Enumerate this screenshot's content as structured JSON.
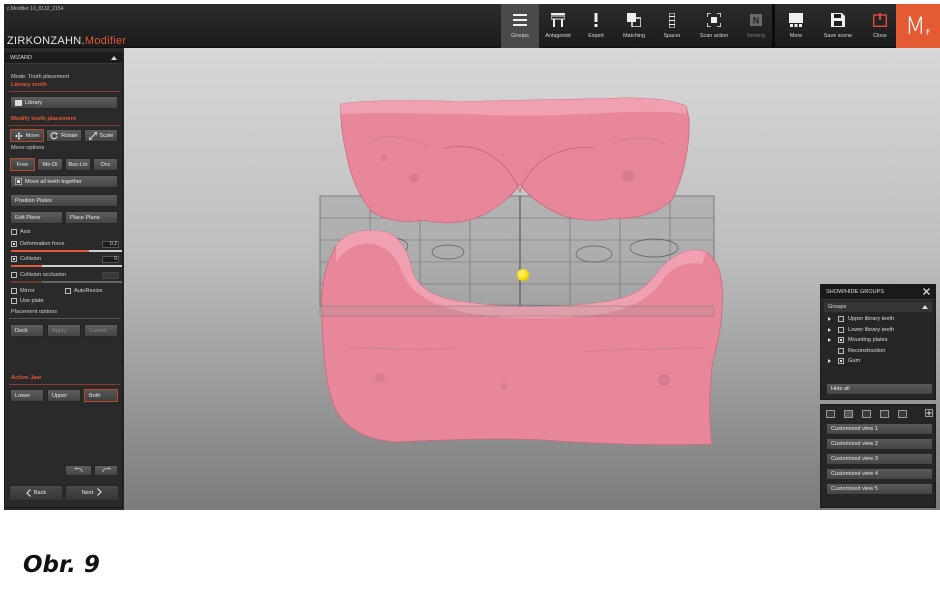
{
  "window": {
    "title": "c.Modifier 10_8132_2154"
  },
  "brand": {
    "name": "ZIRKONZAHN.",
    "product": "Modifier"
  },
  "toolbar": [
    {
      "label": "Groups",
      "icon": "hamburger-icon"
    },
    {
      "label": "Antagonist",
      "icon": "antagonist-icon"
    },
    {
      "label": "Expert",
      "icon": "exclamation-icon"
    },
    {
      "label": "Matching",
      "icon": "matching-icon"
    },
    {
      "label": "Spacer",
      "icon": "spacer-icon"
    },
    {
      "label": "Scan action",
      "icon": "scan-action-icon"
    },
    {
      "label": "Nesting",
      "icon": "nesting-icon"
    }
  ],
  "toolbar_right": [
    {
      "label": "More",
      "icon": "more-icon"
    },
    {
      "label": "Save scene",
      "icon": "save-icon"
    },
    {
      "label": "Close",
      "icon": "power-icon"
    }
  ],
  "logo": {
    "letter": "M",
    "sub": "F",
    "color": "#e35a33"
  },
  "wizard": {
    "title": "WIZARD",
    "mode": "Mode: Tooth placement",
    "library_section": "Library tooth",
    "library_button": "Library",
    "modify_section": "Modify tooth placement",
    "move": "Move",
    "rotate": "Rotate",
    "scale": "Scale",
    "move_options": "Move options",
    "free": "Free",
    "me_di": "Me-Di",
    "buc_lin": "Buc-Lin",
    "occ": "Occ",
    "move_all": "Move all teeth together",
    "position_plates": "Position Plates",
    "edit_plane": "Edit Plane",
    "place_plane": "Place Plane",
    "axis": "Axis",
    "deformation_force": "Deformation force",
    "deformation_value": "0.2",
    "collision": "Collision",
    "collision_value": "0",
    "collision_occlusion": "Collision occlusion",
    "mirror": "Mirror",
    "auto_resize": "AutoResize",
    "use_plate": "Use plate",
    "placement_options": "Placement options",
    "dock": "Dock",
    "apply": "Apply",
    "cancel": "Cancel",
    "active_jaw": "Active Jaw",
    "lower": "Lower",
    "upper": "Upper",
    "both": "Both",
    "back": "Back",
    "next": "Next"
  },
  "groups_panel": {
    "title": "SHOW/HIDE GROUPS",
    "sub": "Groups",
    "items": [
      {
        "label": "Upper library teeth",
        "checked": false,
        "arrow": true,
        "box": true
      },
      {
        "label": "Lower library teeth",
        "checked": false,
        "arrow": true,
        "box": true
      },
      {
        "label": "Mounting plates",
        "checked": true,
        "arrow": true,
        "box": true
      },
      {
        "label": "Reconstruction",
        "checked": false,
        "arrow": false,
        "box": true
      },
      {
        "label": "Gum",
        "checked": true,
        "arrow": true,
        "box": true
      }
    ],
    "hide_all": "Hide all"
  },
  "views": [
    "Customized view 1",
    "Customized view 2",
    "Customized view 3",
    "Customized view 4",
    "Customized view 5"
  ],
  "caption": "Obr. 9",
  "colors": {
    "accent": "#e0593a",
    "gum": "#e8879a",
    "ball": "#f2d800"
  }
}
